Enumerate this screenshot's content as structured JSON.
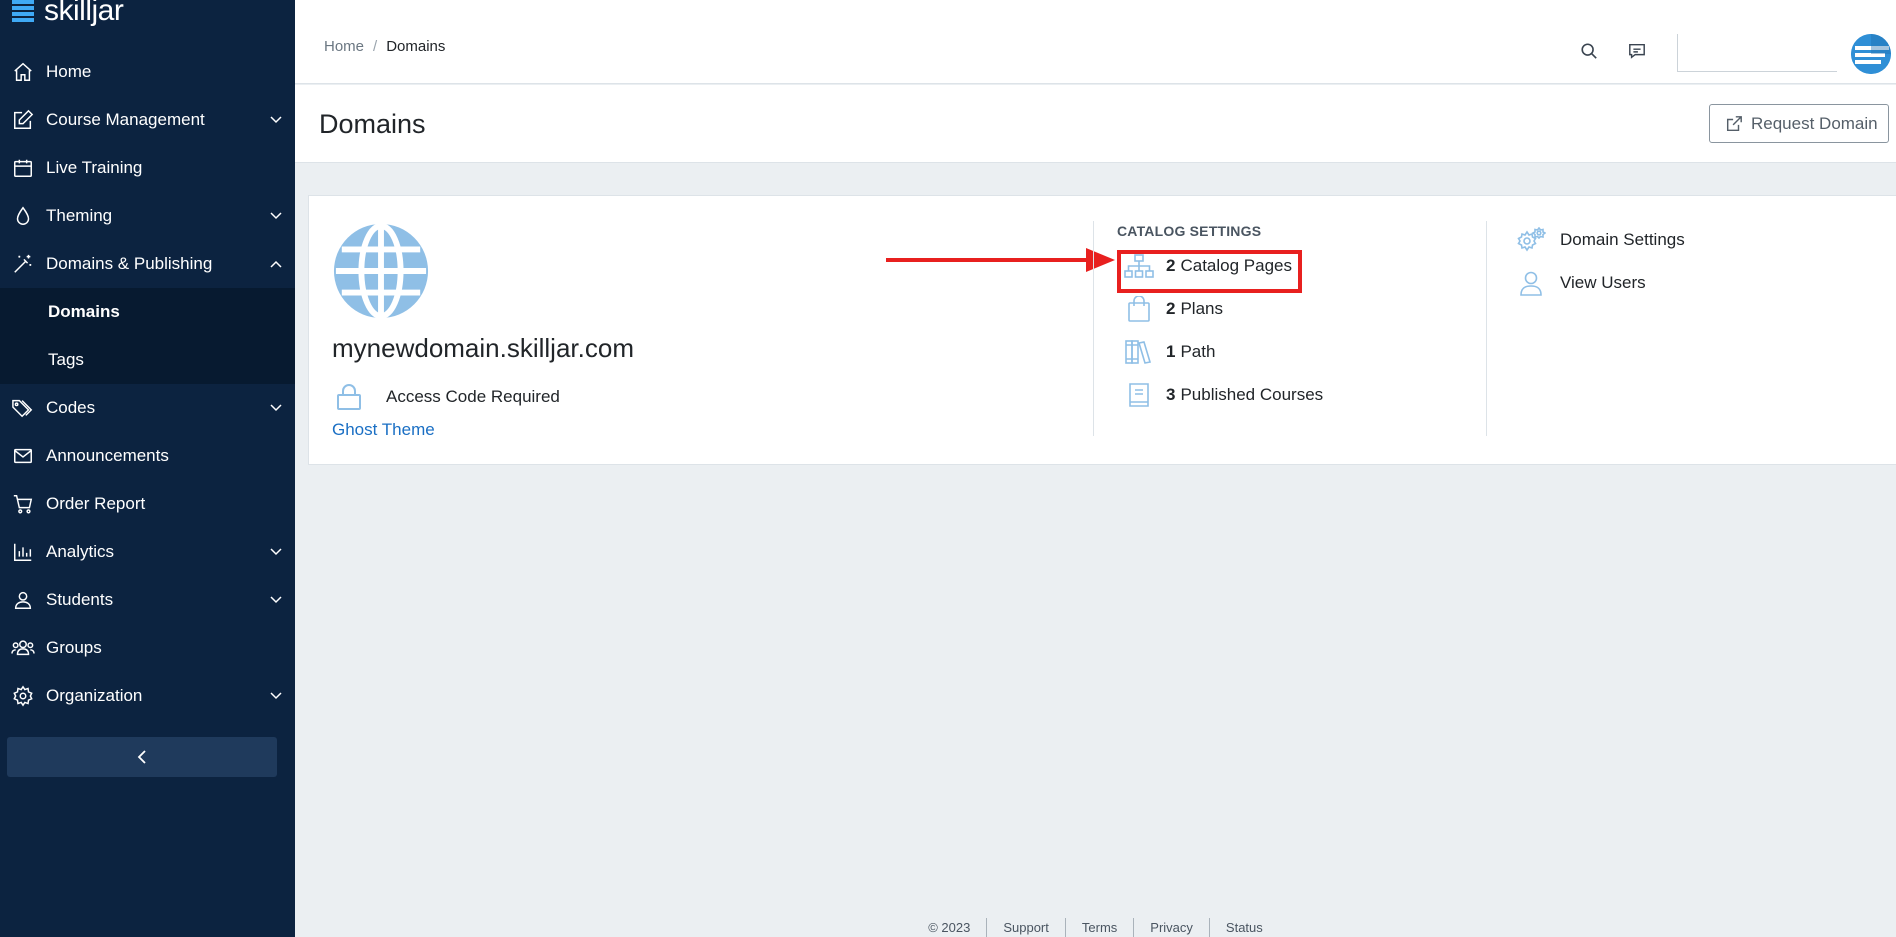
{
  "brand": {
    "name": "skilljar"
  },
  "sidebar": {
    "items": [
      {
        "label": "Home",
        "icon": "home-icon",
        "expandable": false
      },
      {
        "label": "Course Management",
        "icon": "edit-icon",
        "expandable": true
      },
      {
        "label": "Live Training",
        "icon": "calendar-icon",
        "expandable": false
      },
      {
        "label": "Theming",
        "icon": "droplet-icon",
        "expandable": true
      },
      {
        "label": "Domains & Publishing",
        "icon": "magic-wand-icon",
        "expandable": true,
        "expanded": true
      },
      {
        "label": "Codes",
        "icon": "tag-icon",
        "expandable": true
      },
      {
        "label": "Announcements",
        "icon": "envelope-icon",
        "expandable": false
      },
      {
        "label": "Order Report",
        "icon": "cart-icon",
        "expandable": false
      },
      {
        "label": "Analytics",
        "icon": "bar-chart-icon",
        "expandable": true
      },
      {
        "label": "Students",
        "icon": "user-icon",
        "expandable": true
      },
      {
        "label": "Groups",
        "icon": "users-icon",
        "expandable": false
      },
      {
        "label": "Organization",
        "icon": "gear-icon",
        "expandable": true
      }
    ],
    "subitems": [
      {
        "label": "Domains",
        "active": true
      },
      {
        "label": "Tags",
        "active": false
      }
    ]
  },
  "breadcrumb": {
    "home": "Home",
    "separator": "/",
    "current": "Domains"
  },
  "topbar": {
    "search_placeholder": ""
  },
  "page": {
    "title": "Domains",
    "request_button": "Request Domain"
  },
  "domain": {
    "name": "mynewdomain.skilljar.com",
    "access": "Access Code Required",
    "theme": "Ghost Theme"
  },
  "catalog": {
    "title": "CATALOG SETTINGS",
    "items": [
      {
        "count": "2",
        "label": "Catalog Pages",
        "icon": "sitemap-icon"
      },
      {
        "count": "2",
        "label": "Plans",
        "icon": "shopping-bag-icon"
      },
      {
        "count": "1",
        "label": "Path",
        "icon": "books-icon"
      },
      {
        "count": "3",
        "label": "Published Courses",
        "icon": "book-icon"
      }
    ]
  },
  "settings": {
    "domain_settings": "Domain Settings",
    "view_users": "View Users"
  },
  "footer": {
    "copyright": "© 2023",
    "links": [
      "Support",
      "Terms",
      "Privacy",
      "Status"
    ]
  },
  "colors": {
    "sidebar_bg": "#0c2340",
    "accent": "#1a6fc4",
    "icon_light_blue": "#8fbfe6",
    "annotation_red": "#e8201f"
  }
}
